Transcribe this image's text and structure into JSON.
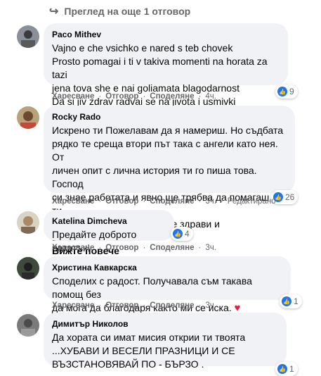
{
  "more_replies": "Преглед на още 1 отговор",
  "labels": {
    "like": "Харесване",
    "reply": "Отговор",
    "share": "Споделяне",
    "see_more": "Вижте повече"
  },
  "comments": [
    {
      "author": "Paco Mithev",
      "lines": [
        "Vajno e che vsichko e nared s teb chovek",
        "Prosto pomagai i ti v takiva momenti na horata za tazi",
        "jena tova she e nai goliamata blagodarnost",
        "Da si jiv zdrav radvai se na jivota i usmivki"
      ],
      "time": "4ч.",
      "reactions": "9"
    },
    {
      "author": "Rocky Rado",
      "lines": [
        "Искрено ти Пожелавам да я намериш. Но съдбата",
        "рядко те среща втори път така с ангели като нея. От",
        "личен опит с лична история ти го пиша това. Господ",
        "си знае работата и явно ще трябва да помагаш и ти",
        "така на хора в беда. Да сте здрави и Благословени вс..."
      ],
      "time": "3ч.",
      "edited": "Редактирано",
      "reactions": "26"
    },
    {
      "author": "Katelina Dimcheva",
      "lines": [
        "Предайте доброто нататък!"
      ],
      "time": "3ч.",
      "reactions": "4"
    },
    {
      "author": "Христина Кавкарска",
      "lines": [
        "Споделих с радост. Получавала съм такава помощ без",
        "да мога да благодаря както ми се иска."
      ],
      "time": "3ч.",
      "reactions": "1"
    },
    {
      "author": "Димитър Николов",
      "lines": [
        "Да хората си имат мисия открии ти твоята",
        "...ХУБАВИ И ВЕСЕЛИ ПРАЗНИЦИ И СЕ",
        "ВЪЗСТАНОВЯВАЙ ПО - БЪРЗО ."
      ],
      "time": "",
      "reactions": "1"
    }
  ],
  "colors": {
    "bubble": "#f0f2f5",
    "meta": "#65676b",
    "like": "#1877f2",
    "heart": "#e41e3f"
  }
}
